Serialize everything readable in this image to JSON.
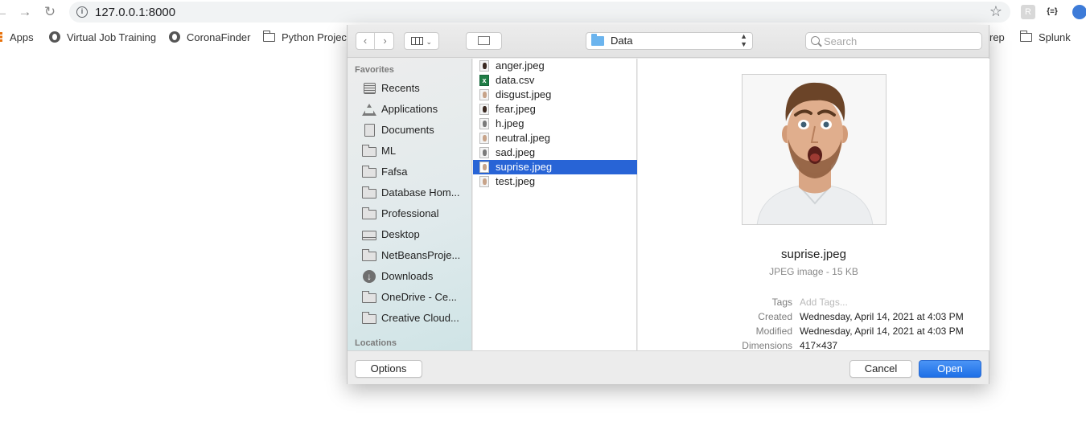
{
  "browser": {
    "url": "127.0.0.1:8000",
    "bookmarks": [
      {
        "label": "Apps"
      },
      {
        "label": "Virtual Job Training"
      },
      {
        "label": "CoronaFinder"
      },
      {
        "label": "Python Projec"
      },
      {
        "label": "rep"
      },
      {
        "label": "Splunk"
      }
    ],
    "extension_label": "{≡}"
  },
  "dialog": {
    "path": "Data",
    "search_placeholder": "Search",
    "sidebar": {
      "favorites_heading": "Favorites",
      "items": [
        {
          "label": "Recents",
          "icon": "recents-icon"
        },
        {
          "label": "Applications",
          "icon": "applications-icon"
        },
        {
          "label": "Documents",
          "icon": "documents-icon"
        },
        {
          "label": "ML",
          "icon": "folder-icon"
        },
        {
          "label": "Fafsa",
          "icon": "folder-icon"
        },
        {
          "label": "Database Hom...",
          "icon": "folder-icon"
        },
        {
          "label": "Professional",
          "icon": "folder-icon"
        },
        {
          "label": "Desktop",
          "icon": "desktop-icon"
        },
        {
          "label": "NetBeansProje...",
          "icon": "folder-icon"
        },
        {
          "label": "Downloads",
          "icon": "downloads-icon"
        },
        {
          "label": "OneDrive - Ce...",
          "icon": "folder-icon"
        },
        {
          "label": "Creative Cloud...",
          "icon": "folder-icon"
        }
      ],
      "locations_heading": "Locations"
    },
    "files": [
      {
        "name": "anger.jpeg",
        "thumb": "dark",
        "selected": false
      },
      {
        "name": "data.csv",
        "thumb": "excel",
        "selected": false
      },
      {
        "name": "disgust.jpeg",
        "thumb": "light",
        "selected": false
      },
      {
        "name": "fear.jpeg",
        "thumb": "dark",
        "selected": false
      },
      {
        "name": "h.jpeg",
        "thumb": "gray",
        "selected": false
      },
      {
        "name": "neutral.jpeg",
        "thumb": "light",
        "selected": false
      },
      {
        "name": "sad.jpeg",
        "thumb": "gray",
        "selected": false
      },
      {
        "name": "suprise.jpeg",
        "thumb": "light",
        "selected": true
      },
      {
        "name": "test.jpeg",
        "thumb": "light",
        "selected": false
      }
    ],
    "preview": {
      "name": "suprise.jpeg",
      "kind": "JPEG image - 15 KB",
      "tags_label": "Tags",
      "tags_placeholder": "Add Tags...",
      "created_label": "Created",
      "created_value": "Wednesday, April 14, 2021 at 4:03 PM",
      "modified_label": "Modified",
      "modified_value": "Wednesday, April 14, 2021 at 4:03 PM",
      "dimensions_label": "Dimensions",
      "dimensions_value": "417×437"
    },
    "buttons": {
      "options": "Options",
      "cancel": "Cancel",
      "open": "Open"
    }
  },
  "colors": {
    "selection": "#2864d6",
    "open_button": "#1e6fe6",
    "folder_blue": "#6bb4ee"
  }
}
